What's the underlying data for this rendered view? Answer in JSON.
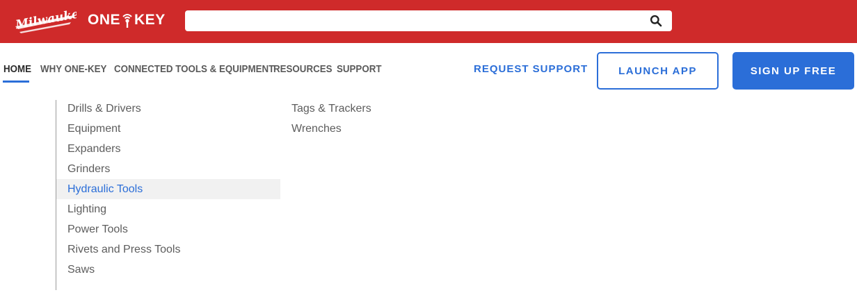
{
  "header": {
    "brand": "Milwaukee",
    "product_logo": "ONE-KEY",
    "search": {
      "placeholder": "",
      "value": "",
      "icon": "search-icon"
    },
    "background_color": "#cf2a2a"
  },
  "nav": {
    "items": [
      {
        "label": "HOME",
        "active": true
      },
      {
        "label": "WHY ONE-KEY",
        "active": false
      },
      {
        "label": "CONNECTED TOOLS & EQUIPMENT",
        "active": false
      },
      {
        "label": "RESOURCES",
        "active": false
      },
      {
        "label": "SUPPORT",
        "active": false
      }
    ],
    "request_support": "REQUEST SUPPORT",
    "launch_app": "LAUNCH APP",
    "sign_up": "SIGN UP FREE",
    "accent_color": "#2b6ed8"
  },
  "dropdown": {
    "column1": [
      {
        "label": "Drills & Drivers",
        "highlighted": false
      },
      {
        "label": "Equipment",
        "highlighted": false
      },
      {
        "label": "Expanders",
        "highlighted": false
      },
      {
        "label": "Grinders",
        "highlighted": false
      },
      {
        "label": "Hydraulic Tools",
        "highlighted": true
      },
      {
        "label": "Lighting",
        "highlighted": false
      },
      {
        "label": "Power Tools",
        "highlighted": false
      },
      {
        "label": "Rivets and Press Tools",
        "highlighted": false
      },
      {
        "label": "Saws",
        "highlighted": false
      }
    ],
    "column2": [
      {
        "label": "Tags & Trackers",
        "highlighted": false
      },
      {
        "label": "Wrenches",
        "highlighted": false
      }
    ]
  }
}
